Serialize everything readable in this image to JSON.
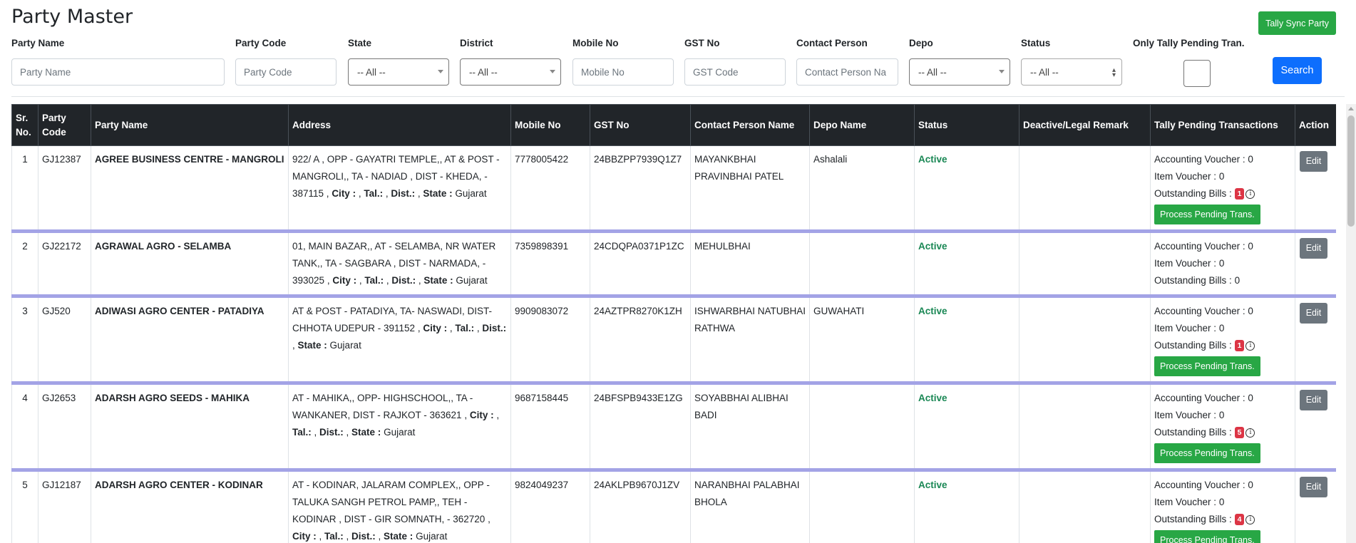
{
  "page": {
    "title": "Party Master",
    "sync_button": "Tally Sync Party",
    "search_button": "Search"
  },
  "filters": {
    "party_name": {
      "label": "Party Name",
      "placeholder": "Party Name"
    },
    "party_code": {
      "label": "Party Code",
      "placeholder": "Party Code"
    },
    "state": {
      "label": "State",
      "value": "-- All --"
    },
    "district": {
      "label": "District",
      "value": "-- All --"
    },
    "mobile_no": {
      "label": "Mobile No",
      "placeholder": "Mobile No"
    },
    "gst_no": {
      "label": "GST No",
      "placeholder": "GST Code"
    },
    "contact_person": {
      "label": "Contact Person",
      "placeholder": "Contact Person Na"
    },
    "depo": {
      "label": "Depo",
      "value": "-- All --"
    },
    "status": {
      "label": "Status",
      "value": "-- All --"
    },
    "only_tally_pending": {
      "label": "Only Tally Pending Tran."
    }
  },
  "table": {
    "headers": {
      "sr": "Sr. No.",
      "code": "Party Code",
      "name": "Party Name",
      "address": "Address",
      "mobile": "Mobile No",
      "gst": "GST No",
      "contact": "Contact Person Name",
      "depo": "Depo Name",
      "status": "Status",
      "remark": "Deactive/Legal Remark",
      "tally": "Tally Pending Transactions",
      "action": "Action"
    },
    "labels": {
      "city": "City :",
      "tal": "Tal.:",
      "dist": "Dist.:",
      "state": "State :",
      "accounting": "Accounting Voucher :",
      "item": "Item Voucher :",
      "outstanding": "Outstanding Bills :",
      "process": "Process Pending Trans.",
      "edit": "Edit",
      "info": "i"
    },
    "rows": [
      {
        "sr": "1",
        "code": "GJ12387",
        "name": "AGREE BUSINESS CENTRE - MANGROLI",
        "address": "922/ A , OPP - GAYATRI TEMPLE,, AT & POST - MANGROLI,, TA - NADIAD , DIST - KHEDA, - 387115",
        "state": "Gujarat",
        "mobile": "7778005422",
        "gst": "24BBZPP7939Q1Z7",
        "contact": "MAYANKBHAI PRAVINBHAI PATEL",
        "depo": "Ashalali",
        "status": "Active",
        "remark": "",
        "accounting": "0",
        "item": "0",
        "outstanding": "1",
        "pending": true
      },
      {
        "sr": "2",
        "code": "GJ22172",
        "name": "AGRAWAL AGRO - SELAMBA",
        "address": "01, MAIN BAZAR,, AT - SELAMBA, NR WATER TANK,, TA - SAGBARA , DIST - NARMADA, - 393025",
        "state": "Gujarat",
        "mobile": "7359898391",
        "gst": "24CDQPA0371P1ZC",
        "contact": "MEHULBHAI",
        "depo": "",
        "status": "Active",
        "remark": "",
        "accounting": "0",
        "item": "0",
        "outstanding": "0",
        "pending": false
      },
      {
        "sr": "3",
        "code": "GJ520",
        "name": "ADIWASI AGRO CENTER - PATADIYA",
        "address": "AT & POST - PATADIYA, TA- NASWADI, DIST- CHHOTA UDEPUR - 391152",
        "state": "Gujarat",
        "mobile": "9909083072",
        "gst": "24AZTPR8270K1ZH",
        "contact": "ISHWARBHAI NATUBHAI RATHWA",
        "depo": "GUWAHATI",
        "status": "Active",
        "remark": "",
        "accounting": "0",
        "item": "0",
        "outstanding": "1",
        "pending": true
      },
      {
        "sr": "4",
        "code": "GJ2653",
        "name": "ADARSH AGRO SEEDS - MAHIKA",
        "address": "AT - MAHIKA,, OPP- HIGHSCHOOL,, TA - WANKANER, DIST - RAJKOT - 363621",
        "state": "Gujarat",
        "mobile": "9687158445",
        "gst": "24BFSPB9433E1ZG",
        "contact": "SOYABBHAI ALIBHAI BADI",
        "depo": "",
        "status": "Active",
        "remark": "",
        "accounting": "0",
        "item": "0",
        "outstanding": "5",
        "pending": true
      },
      {
        "sr": "5",
        "code": "GJ12187",
        "name": "ADARSH AGRO CENTER - KODINAR",
        "address": "AT - KODINAR, JALARAM COMPLEX,, OPP - TALUKA SANGH PETROL PAMP,, TEH - KODINAR , DIST - GIR SOMNATH, - 362720",
        "state": "Gujarat",
        "mobile": "9824049237",
        "gst": "24AKLPB9670J1ZV",
        "contact": "NARANBHAI PALABHAI BHOLA",
        "depo": "",
        "status": "Active",
        "remark": "",
        "accounting": "0",
        "item": "0",
        "outstanding": "4",
        "pending": true
      }
    ]
  },
  "colors": {
    "primary": "#0d6efd",
    "success": "#28a745",
    "danger": "#dc3545",
    "header_bg": "#212529",
    "row_separator": "#a3a3e6"
  }
}
